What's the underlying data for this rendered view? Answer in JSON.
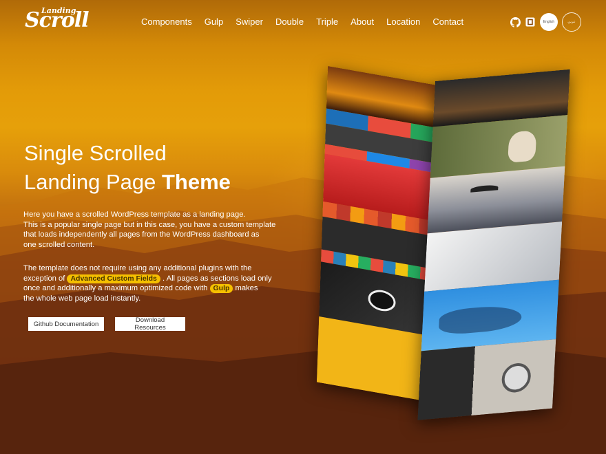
{
  "logo": {
    "small": "Landing",
    "big": "Scroll"
  },
  "nav": [
    {
      "label": "Components"
    },
    {
      "label": "Gulp"
    },
    {
      "label": "Swiper"
    },
    {
      "label": "Double"
    },
    {
      "label": "Triple"
    },
    {
      "label": "About"
    },
    {
      "label": "Location"
    },
    {
      "label": "Contact"
    }
  ],
  "header_icons": {
    "github": "github-icon",
    "codepen": "codepen-icon"
  },
  "lang": {
    "english": "English",
    "arabic": "عربي"
  },
  "hero": {
    "title_line1": "Single Scrolled",
    "title_line2_prefix": "Landing Page ",
    "title_line2_bold": "Theme",
    "p1_l1": "Here you have a scrolled WordPress template as a landing page.",
    "p1_l2": "This is a popular single page but in this case, you have a custom template",
    "p1_l3": "that loads independently all pages from the WordPress dashboard as",
    "p1_l4": "one scrolled content.",
    "p2_l1": "The template does not require using any additional plugins with the",
    "p2_l2_pre": "exception of ",
    "p2_pill_acf": "Advanced Custom Fields",
    "p2_l2_post": " . All pages as sections load only",
    "p2_l3_pre": "once and additionally a maximum optimized code with ",
    "p2_pill_gulp": "Gulp",
    "p2_l3_post": " makes",
    "p2_l4": "the whole web page load instantly."
  },
  "buttons": {
    "github_docs": "Github Documentation",
    "download": "Download Resources"
  },
  "colors": {
    "pill_bg": "#f5c000",
    "sky_top": "#b06a08",
    "sky_mid": "#e6a00a",
    "ground": "#4a1c0e"
  }
}
